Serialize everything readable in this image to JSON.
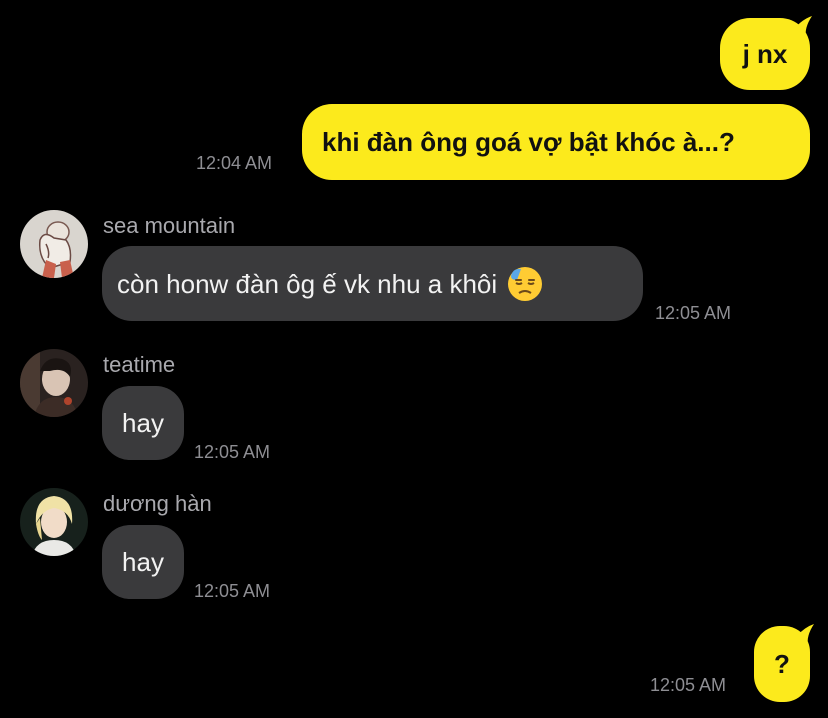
{
  "messages": [
    {
      "id": "m1",
      "direction": "outgoing",
      "text": "j nx"
    },
    {
      "id": "m2",
      "direction": "outgoing",
      "text": "khi đàn ông goá vợ bật khóc à...?",
      "time": "12:04 AM"
    },
    {
      "id": "m3",
      "direction": "incoming",
      "sender": "sea mountain",
      "text": "còn honw đàn ôg ế vk nhu a khôi",
      "emoji": "downcast-face-with-sweat-emoji",
      "time": "12:05 AM"
    },
    {
      "id": "m4",
      "direction": "incoming",
      "sender": "teatime",
      "text": "hay",
      "time": "12:05 AM"
    },
    {
      "id": "m5",
      "direction": "incoming",
      "sender": "dương hàn",
      "text": "hay",
      "time": "12:05 AM"
    },
    {
      "id": "m6",
      "direction": "outgoing",
      "text": "?",
      "time": "12:05 AM"
    }
  ],
  "colors": {
    "background": "#000000",
    "outgoing_bubble": "#fcea1c",
    "incoming_bubble": "#3a3a3c",
    "timestamp": "#8e8e93",
    "sender_name": "#a9a9ae"
  }
}
